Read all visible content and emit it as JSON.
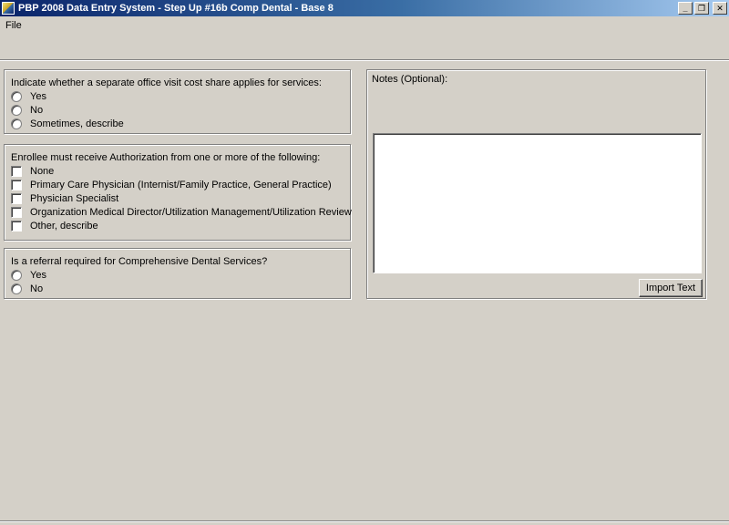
{
  "window": {
    "title": "PBP 2008 Data Entry System - Step Up #16b Comp Dental - Base 8",
    "controls": {
      "minimize": "_",
      "restore": "❐",
      "close": "✕"
    }
  },
  "menu": {
    "file": "File"
  },
  "cost_share": {
    "question": "Indicate whether a separate office visit cost share applies for services:",
    "options": [
      "Yes",
      "No",
      "Sometimes, describe"
    ]
  },
  "authorization": {
    "question": "Enrollee must receive Authorization from one or more of the following:",
    "options": [
      "None",
      "Primary Care Physician (Internist/Family Practice, General Practice)",
      "Physician Specialist",
      "Organization Medical Director/Utilization Management/Utilization Review",
      "Other, describe"
    ]
  },
  "referral": {
    "question": "Is a referral required for Comprehensive Dental Services?",
    "options": [
      "Yes",
      "No"
    ]
  },
  "notes": {
    "label": "Notes (Optional):",
    "value": "",
    "import_button": "Import Text"
  }
}
